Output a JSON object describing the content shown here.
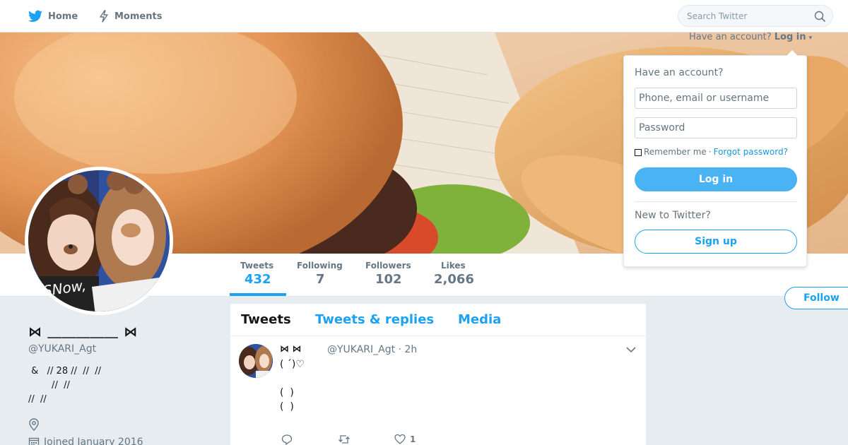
{
  "nav": {
    "home_label": "Home",
    "moments_label": "Moments",
    "search_placeholder": "Search Twitter"
  },
  "login": {
    "prompt": "Have an account?",
    "link_label": "Log in",
    "menu_title": "Have an account?",
    "username_placeholder": "Phone, email or username",
    "password_placeholder": "Password",
    "remember_label": "Remember me",
    "separator": "·",
    "forgot_label": "Forgot password?",
    "login_button": "Log in",
    "new_prompt": "New to Twitter?",
    "signup_button": "Sign up"
  },
  "stats": [
    {
      "label": "Tweets",
      "value": "432"
    },
    {
      "label": "Following",
      "value": "7"
    },
    {
      "label": "Followers",
      "value": "102"
    },
    {
      "label": "Likes",
      "value": "2,066"
    }
  ],
  "follow_label": "Follow",
  "profile": {
    "display_name": "⋈ ＿＿＿＿＿ ⋈",
    "handle": "@YUKARI_Agt",
    "bio": " &   // 28 //  //  //\n        //  //\n//  //",
    "joined": "Joined January 2016"
  },
  "tabs": [
    "Tweets",
    "Tweets & replies",
    "Media"
  ],
  "tweet": {
    "name": "⋈  ⋈",
    "handle": "@YUKARI_Agt",
    "separator": "·",
    "time": "2h",
    "text": "( ´)♡\n\n(  )\n(  )",
    "like_count": "1"
  },
  "colors": {
    "accent": "#1da1f2",
    "login_button": "#4ab3f4",
    "background": "#e6ecf0"
  }
}
